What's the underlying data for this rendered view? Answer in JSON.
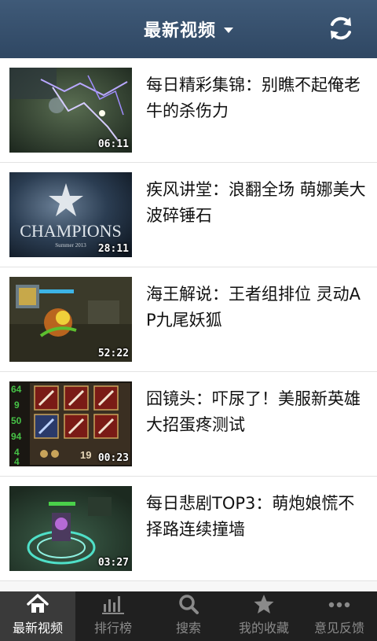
{
  "header": {
    "title": "最新视频",
    "dropdown_icon": "caret-down-icon",
    "refresh_icon": "refresh-icon"
  },
  "videos": [
    {
      "title": "每日精彩集锦：别瞧不起俺老牛的杀伤力",
      "duration": "06:11"
    },
    {
      "title": "疾风讲堂：浪翻全场 萌娜美大波碎锤石",
      "duration": "28:11",
      "thumb_text": "CHAMPIONS",
      "thumb_subtext": "Summer 2013"
    },
    {
      "title": "海王解说：王者组排位 灵动AP九尾妖狐",
      "duration": "52:22"
    },
    {
      "title": "囧镜头：吓尿了！美服新英雄大招蛋疼测试",
      "duration": "00:23",
      "thumb_numbers": [
        "64",
        "9",
        "50",
        "94",
        "4",
        "4",
        "19"
      ]
    },
    {
      "title": "每日悲剧TOP3：萌炮娘慌不择路连续撞墙",
      "duration": "03:27"
    }
  ],
  "tabbar": {
    "tabs": [
      {
        "label": "最新视频",
        "icon": "home-icon",
        "active": true
      },
      {
        "label": "排行榜",
        "icon": "bar-chart-icon",
        "active": false
      },
      {
        "label": "搜索",
        "icon": "search-icon",
        "active": false
      },
      {
        "label": "我的收藏",
        "icon": "star-icon",
        "active": false
      },
      {
        "label": "意见反馈",
        "icon": "more-icon",
        "active": false
      }
    ]
  },
  "colors": {
    "header_bg": "#34506d",
    "tabbar_bg": "#202020",
    "tab_active_bg": "#3a3a3a"
  }
}
